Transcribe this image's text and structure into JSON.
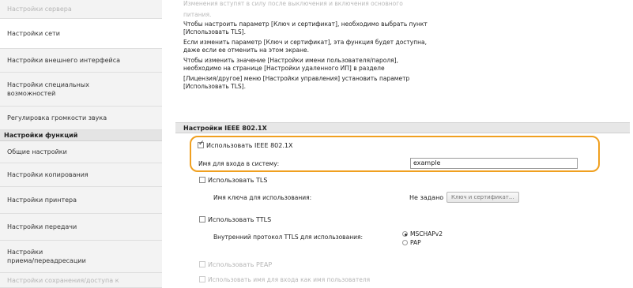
{
  "sidebar": {
    "top_item": "Настройки сервера",
    "items": [
      {
        "label": "Настройки сети",
        "lines": [
          "Настройки сети"
        ]
      },
      {
        "label": "Настройки внешнего интерфейса",
        "lines": [
          "Настройки внешнего интерфейса"
        ]
      },
      {
        "label": "Настройки специальных возможностей",
        "lines": [
          "Настройки специальных",
          "возможностей"
        ]
      },
      {
        "label": "Регулировка громкости звука",
        "lines": [
          "Регулировка громкости звука"
        ]
      }
    ],
    "section_header": "Настройки функций",
    "func_items": [
      {
        "lines": [
          "Общие настройки"
        ]
      },
      {
        "lines": [
          "Настройки копирования"
        ]
      },
      {
        "lines": [
          "Настройки принтера"
        ]
      },
      {
        "lines": [
          "Настройки передачи"
        ]
      },
      {
        "lines": [
          "Настройки",
          "приема/переадресации"
        ]
      }
    ],
    "bottom_item": "Настройки сохранения/доступа к"
  },
  "notice": {
    "lines": [
      "Изменения вступят в силу после выключения и включения основного",
      "питания.",
      "Чтобы настроить параметр [Ключ и сертификат], необходимо выбрать пункт",
      "[Использовать TLS].",
      "Если изменить параметр [Ключ и сертификат], эта функция будет доступна,",
      "даже если ее отменить на этом экране.",
      "Чтобы изменить значение [Настройки имени пользователя/пароля],",
      "необходимо на странице [Настройки удаленного ИП] в разделе",
      "[Лицензия/другое] меню [Настройки управления] установить параметр",
      "[Использовать TLS]."
    ]
  },
  "ieee": {
    "section_title": "Настройки IEEE 802.1X",
    "use_ieee_label": "Использовать IEEE 802.1X",
    "use_ieee_checked": true,
    "login_name_label": "Имя для входа в систему:",
    "login_name_value": "example",
    "use_tls_label": "Использовать TLS",
    "use_tls_checked": false,
    "key_name_label": "Имя ключа для использования:",
    "key_name_value": "Не задано",
    "key_cert_button": "Ключ и сертификат...",
    "use_ttls_label": "Использовать TTLS",
    "use_ttls_checked": false,
    "ttls_protocol_label": "Внутренний протокол TTLS для использования:",
    "ttls_options": [
      "MSCHAPv2",
      "PAP"
    ],
    "ttls_selected": "MSCHAPv2",
    "use_peap_label": "Использовать PEAP",
    "use_peap_checked": false,
    "use_login_as_user_label": "Использовать имя для входа как имя пользователя"
  },
  "colors": {
    "highlight": "#f0a020",
    "section_bg": "#e7e7e7"
  }
}
